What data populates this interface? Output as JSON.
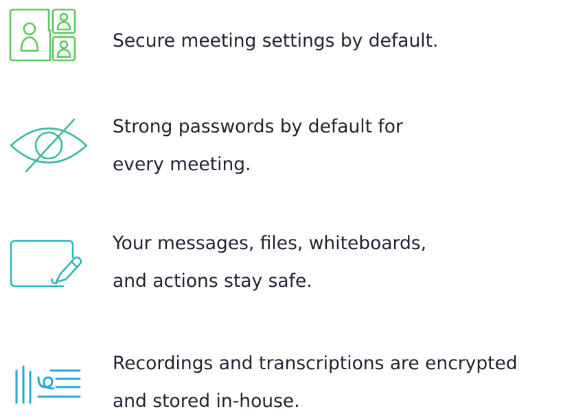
{
  "features": [
    {
      "icon": "participants-shield-icon",
      "color": "#5cc85e",
      "lines": [
        "Secure meeting settings by default."
      ]
    },
    {
      "icon": "eye-slash-icon",
      "color": "#3db9a0",
      "lines": [
        "Strong passwords by default for",
        "every meeting."
      ]
    },
    {
      "icon": "whiteboard-pen-icon",
      "color": "#2fb6b8",
      "lines": [
        "Your messages, files, whiteboards,",
        "and actions stay safe."
      ]
    },
    {
      "icon": "transcript-icon",
      "color": "#22a8d8",
      "lines": [
        "Recordings and transcriptions are encrypted",
        "and stored in-house."
      ]
    }
  ],
  "colors": {
    "text": "#1f2230",
    "green": "#5cc85e",
    "teal": "#3db9a0",
    "cyan": "#2fb6b8",
    "blue": "#22a8d8"
  }
}
